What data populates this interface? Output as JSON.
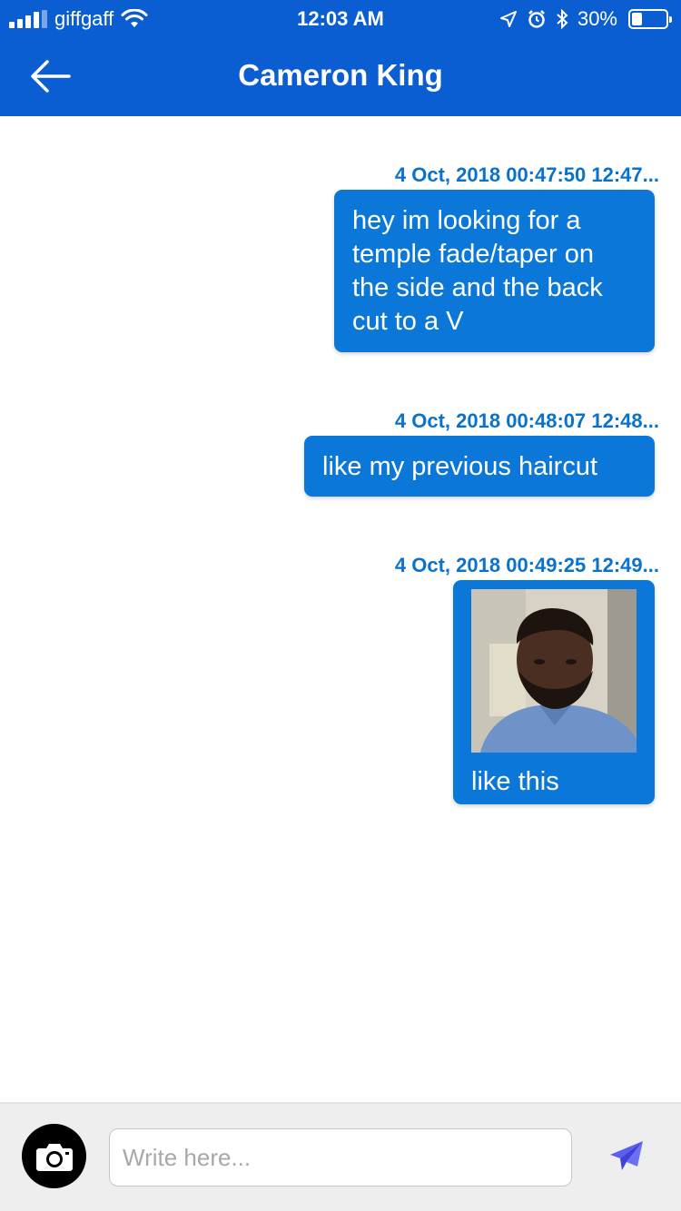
{
  "status_bar": {
    "carrier": "giffgaff",
    "time": "12:03 AM",
    "battery": "30%",
    "battery_level": 0.3
  },
  "header": {
    "title": "Cameron King",
    "back_icon": "arrow-left-icon"
  },
  "messages": [
    {
      "timestamp": "4 Oct, 2018 00:47:50 12:47...",
      "text": "hey im looking for a temple fade/taper on the side and the back cut to a V"
    },
    {
      "timestamp": "4 Oct, 2018 00:48:07 12:48...",
      "text": "like my previous haircut"
    },
    {
      "timestamp": "4 Oct, 2018 00:49:25 12:49...",
      "text": "like this",
      "has_photo": true
    }
  ],
  "composer": {
    "placeholder": "Write here...",
    "camera_icon": "camera-icon",
    "send_icon": "paper-plane-icon"
  },
  "colors": {
    "header_bg": "#0b5ed1",
    "bubble_bg": "#0b78d9",
    "timestamp_text": "#0b72cc",
    "send_icon": "#5b5ef0"
  }
}
